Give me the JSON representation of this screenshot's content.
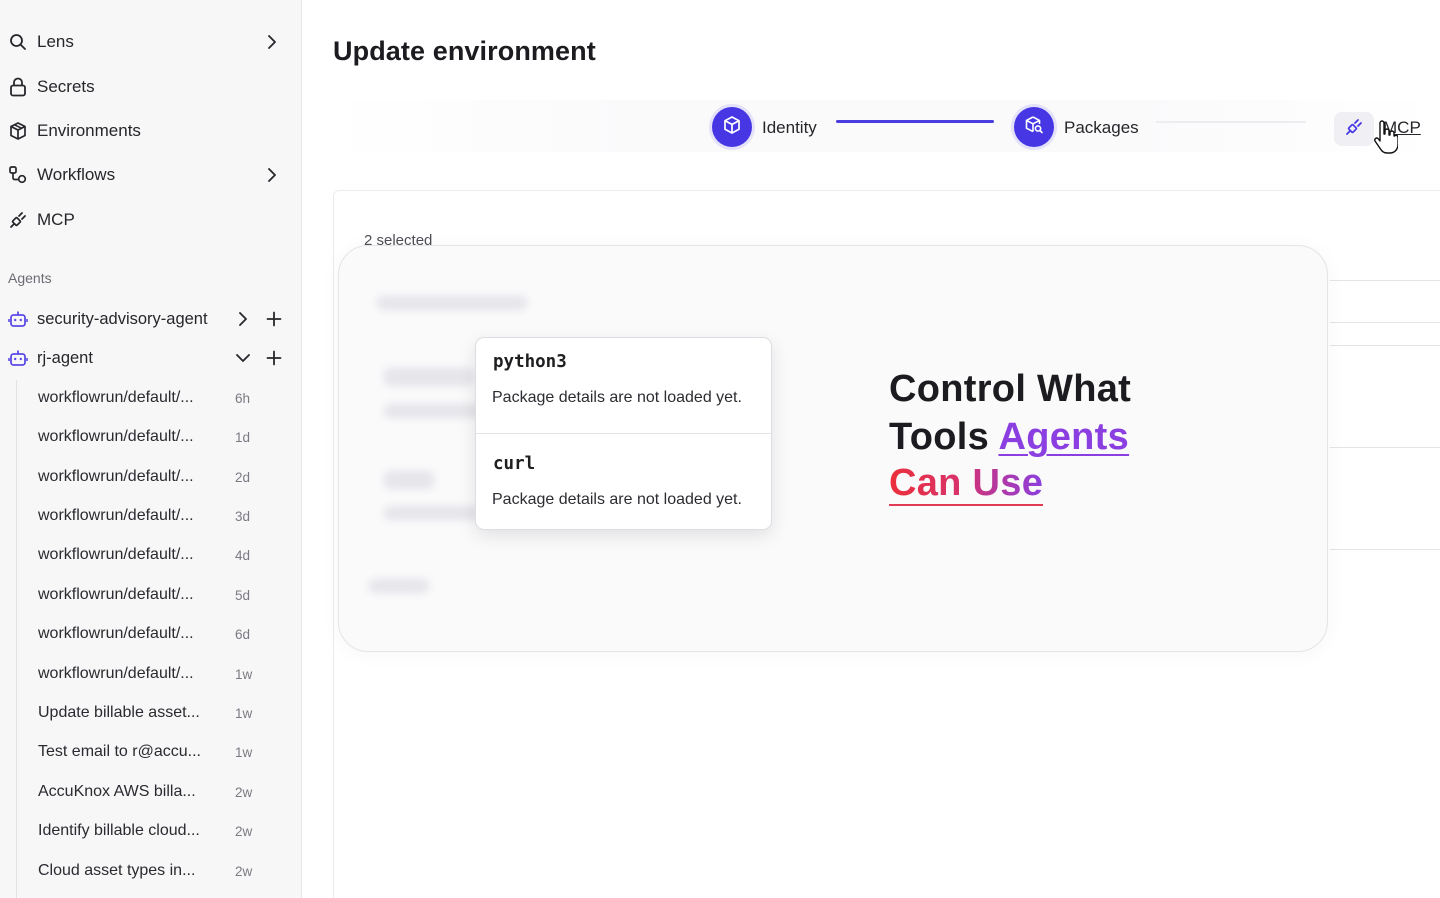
{
  "sidebar": {
    "nav": [
      {
        "label": "Lens",
        "icon": "search-icon",
        "has_chevron": true
      },
      {
        "label": "Secrets",
        "icon": "lock-icon",
        "has_chevron": false
      },
      {
        "label": "Environments",
        "icon": "package-icon",
        "has_chevron": false
      },
      {
        "label": "Workflows",
        "icon": "workflow-icon",
        "has_chevron": true
      },
      {
        "label": "MCP",
        "icon": "plug-icon",
        "has_chevron": false
      }
    ],
    "section_label": "Agents",
    "agents": [
      {
        "label": "security-advisory-agent",
        "icon": "bot-icon",
        "expanded": false
      },
      {
        "label": "rj-agent",
        "icon": "bot-icon",
        "expanded": true
      }
    ],
    "runs": [
      {
        "name": "workflowrun/default/...",
        "time": "6h"
      },
      {
        "name": "workflowrun/default/...",
        "time": "1d"
      },
      {
        "name": "workflowrun/default/...",
        "time": "2d"
      },
      {
        "name": "workflowrun/default/...",
        "time": "3d"
      },
      {
        "name": "workflowrun/default/...",
        "time": "4d"
      },
      {
        "name": "workflowrun/default/...",
        "time": "5d"
      },
      {
        "name": "workflowrun/default/...",
        "time": "6d"
      },
      {
        "name": "workflowrun/default/...",
        "time": "1w"
      },
      {
        "name": "Update billable asset...",
        "time": "1w"
      },
      {
        "name": "Test email to r@accu...",
        "time": "1w"
      },
      {
        "name": "AccuKnox AWS billa...",
        "time": "2w"
      },
      {
        "name": "Identify billable cloud...",
        "time": "2w"
      },
      {
        "name": "Cloud asset types in...",
        "time": "2w"
      }
    ]
  },
  "main": {
    "title": "Update environment",
    "steps": [
      {
        "label": "Identity",
        "icon": "cube-icon",
        "state": "complete"
      },
      {
        "label": "Packages",
        "icon": "package-search-icon",
        "state": "complete"
      },
      {
        "label": "MCP",
        "icon": "plug-icon",
        "state": "current"
      }
    ],
    "selected_text": "2 selected",
    "packages": [
      {
        "name": "python3",
        "description": "Package details are not loaded yet."
      },
      {
        "name": "curl",
        "description": "Package details are not loaded yet."
      }
    ],
    "headline": {
      "line1": "Control What",
      "line2_prefix": "Tools ",
      "line2_accent": "Agents",
      "line3": "Can Use"
    }
  },
  "colors": {
    "accent": "#4636e4",
    "agent_icon": "#5b4ae6",
    "headline_purple": "#8b3fe0",
    "headline_red": "#ec2f3a"
  }
}
